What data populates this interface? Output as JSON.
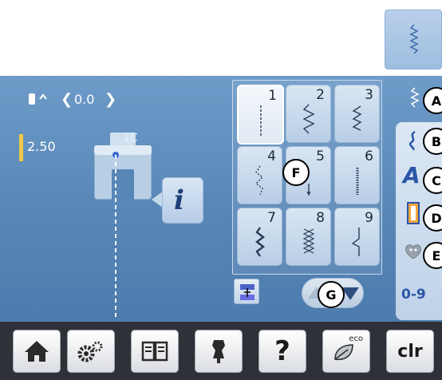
{
  "top_stitch_button": {
    "icon": "zigzag-stitch-icon"
  },
  "needle": {
    "position_label": "0.0",
    "icon": "needle-position-icon"
  },
  "stitch_width": {
    "value": "2.50"
  },
  "foot": {
    "label": "1C"
  },
  "info": {
    "label": "i"
  },
  "stitches": [
    {
      "number": "1",
      "icon": "straight-stitch-icon"
    },
    {
      "number": "2",
      "icon": "zigzag-stitch-icon"
    },
    {
      "number": "3",
      "icon": "vari-overlock-icon"
    },
    {
      "number": "4",
      "icon": "running-stitch-icon"
    },
    {
      "number": "5",
      "icon": "securing-stitch-icon"
    },
    {
      "number": "6",
      "icon": "triple-straight-icon"
    },
    {
      "number": "7",
      "icon": "triple-zigzag-icon"
    },
    {
      "number": "8",
      "icon": "honeycomb-stitch-icon"
    },
    {
      "number": "9",
      "icon": "blindstitch-icon"
    }
  ],
  "markers": {
    "A": "A",
    "B": "B",
    "C": "C",
    "D": "D",
    "E": "E",
    "F": "F",
    "G": "G"
  },
  "sidebar": {
    "letter_mode": "A",
    "numbers_label": "0-9"
  },
  "bottom": {
    "eco_label": "eco",
    "clr_label": "clr",
    "help_label": "?"
  },
  "colors": {
    "screen_blue": "#5887b7",
    "accent_blue": "#2a56a6",
    "bar_dark": "#2f3138"
  }
}
